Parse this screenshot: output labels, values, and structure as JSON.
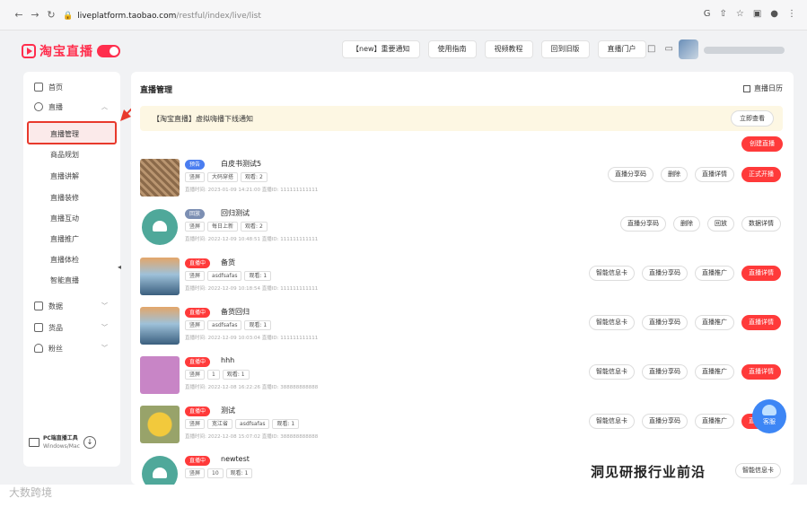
{
  "browser": {
    "url_host": "liveplatform.taobao.com",
    "url_path": "/restful/index/live/list"
  },
  "brand": {
    "logo_text": "淘宝直播"
  },
  "top_nav": [
    "【new】重要通知",
    "使用指南",
    "视频教程",
    "回到旧版",
    "直播门户"
  ],
  "sidebar": {
    "items": [
      {
        "label": "首页"
      },
      {
        "label": "直播"
      }
    ],
    "active": "直播管理",
    "sub_items": [
      "商品规划",
      "直播讲解",
      "直播装修",
      "直播互动",
      "直播推广",
      "直播体检",
      "智能直播"
    ],
    "bottom_items": [
      {
        "label": "数据"
      },
      {
        "label": "货品"
      },
      {
        "label": "粉丝"
      }
    ],
    "pc_tool_title": "PC端直播工具",
    "pc_tool_sub": "Windows/Mac"
  },
  "main": {
    "title": "直播管理",
    "calendar_label": "直播日历",
    "notice_text": "【淘宝直播】虚拟嗨播下线通知",
    "notice_button": "立即查看",
    "create_button": "创建直播"
  },
  "rows": [
    {
      "thumb": "brown",
      "badge": "预告",
      "badge_color": "blue",
      "title": "白皮书测试5",
      "tags": [
        "竖屏",
        "大码穿搭",
        "观看: 2"
      ],
      "meta": "直播时间: 2023-01-09 14:21:00    直播ID: 111111111111",
      "actions": [
        "直播分享码",
        "删除",
        "直播详情",
        "正式开播"
      ]
    },
    {
      "thumb": "android",
      "badge": "回放",
      "badge_color": "gray",
      "title": "回归测试",
      "tags": [
        "竖屏",
        "每日上新",
        "观看: 2"
      ],
      "meta": "直播时间: 2022-12-09 10:48:51    直播ID: 111111111111",
      "actions": [
        "直播分享码",
        "删除",
        "回放",
        "数据详情"
      ]
    },
    {
      "thumb": "sea",
      "badge": "直播中",
      "badge_color": "red",
      "title": "备货",
      "tags": [
        "竖屏",
        "asdfsafas",
        "观看: 1"
      ],
      "meta": "直播时间: 2022-12-09 10:18:54    直播ID: 111111111111",
      "actions": [
        "智能信息卡",
        "直播分享码",
        "直播推广",
        "直播详情"
      ]
    },
    {
      "thumb": "sea",
      "badge": "直播中",
      "badge_color": "red",
      "title": "备货回归",
      "tags": [
        "竖屏",
        "asdfsafas",
        "观看: 1"
      ],
      "meta": "直播时间: 2022-12-09 10:03:04    直播ID: 111111111111",
      "actions": [
        "智能信息卡",
        "直播分享码",
        "直播推广",
        "直播详情"
      ]
    },
    {
      "thumb": "purple",
      "badge": "直播中",
      "badge_color": "red",
      "title": "hhh",
      "tags": [
        "竖屏",
        "1",
        "观看: 1"
      ],
      "meta": "直播时间: 2022-12-08 16:22:26    直播ID: 388888888888",
      "actions": [
        "智能信息卡",
        "直播分享码",
        "直播推广",
        "直播详情"
      ]
    },
    {
      "thumb": "flower",
      "badge": "直播中",
      "badge_color": "red",
      "title": "测试",
      "tags": [
        "竖屏",
        "宽江省",
        "asdfsafas",
        "观看: 1"
      ],
      "meta": "直播时间: 2022-12-08 15:07:02    直播ID: 388888888888",
      "actions": [
        "智能信息卡",
        "直播分享码",
        "直播推广",
        "直播详情"
      ]
    },
    {
      "thumb": "android",
      "badge": "直播中",
      "badge_color": "red",
      "title": "newtest",
      "tags": [
        "竖屏",
        "10",
        "观看: 1"
      ],
      "meta": "",
      "actions": [
        "智能信息卡"
      ]
    }
  ],
  "service_label": "客服",
  "watermark": "洞见研报行业前沿",
  "watermark_logo": "大数跨境"
}
